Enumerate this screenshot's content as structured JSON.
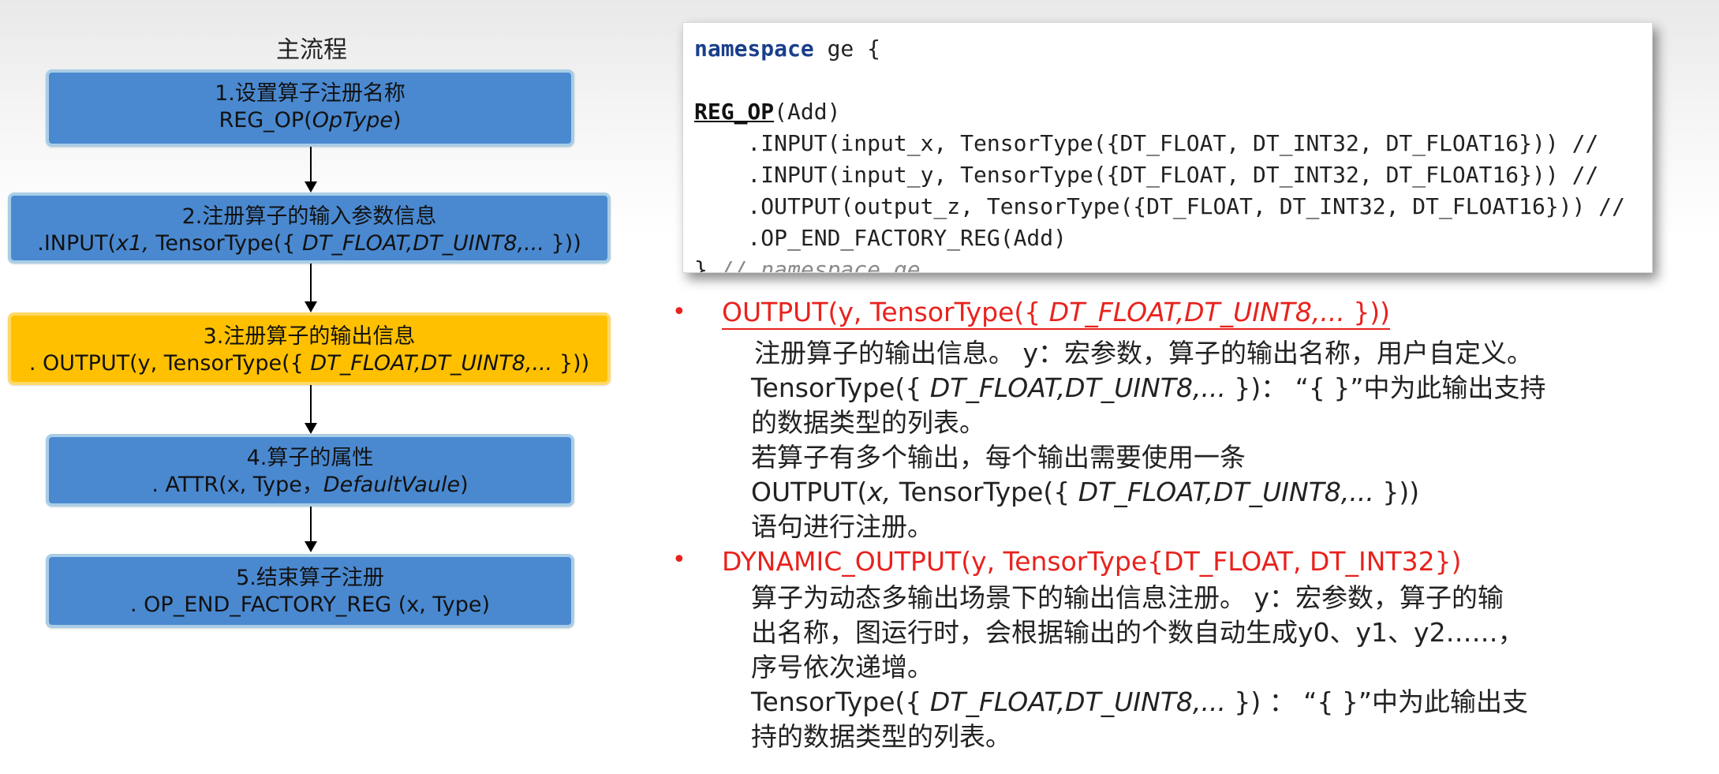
{
  "flow": {
    "title": "主流程",
    "steps": [
      {
        "title": "1.设置算子注册名称",
        "code_pre": "REG_OP(",
        "code_it": "OpType",
        "code_post": ")"
      },
      {
        "title": "2.注册算子的输入参数信息",
        "code_pre": ".INPUT(",
        "code_it": "x1,",
        "code_mid": " TensorType({ ",
        "code_it2": "DT_FLOAT,DT_UINT8,... ",
        "code_post": "}))"
      },
      {
        "title": "3.注册算子的输出信息",
        "code_pre": ". OUTPUT(y, TensorType({ ",
        "code_it": "DT_FLOAT,DT_UINT8,... ",
        "code_post": "}))"
      },
      {
        "title": "4.算子的属性",
        "code_pre": ". ATTR(x, Type，",
        "code_it": "DefaultVaule",
        "code_post": ")"
      },
      {
        "title": "5.结束算子注册",
        "code_pre": ". OP_END_FACTORY_REG (x, Type)"
      }
    ],
    "colors": {
      "blue": "#4a89d0",
      "orange": "#ffc000"
    }
  },
  "code": {
    "ns_kw": "namespace",
    "ns_rest": " ge {",
    "reg_kw": "REG_OP",
    "reg_rest": "(Add)",
    "l1": "    .INPUT(input_x, TensorType({DT_FLOAT, DT_INT32, DT_FLOAT16})) //",
    "l2": "    .INPUT(input_y, TensorType({DT_FLOAT, DT_INT32, DT_FLOAT16})) //",
    "l3": "    .OUTPUT(output_z, TensorType({DT_FLOAT, DT_INT32, DT_FLOAT16})) //",
    "l4": "    .OP_END_FACTORY_REG(Add)",
    "close_brace": "}",
    "close_comment": " // namespace ge"
  },
  "notes": {
    "b1_pre": "OUTPUT(y, TensorType({ ",
    "b1_it": "DT_FLOAT,DT_UINT8,... ",
    "b1_post": "}))",
    "b1_l1": "注册算子的输出信息。 y：宏参数，算子的输出名称，用户自定义。",
    "b1_l2_pre": "TensorType({ ",
    "b1_l2_it": "DT_FLOAT,DT_UINT8,... ",
    "b1_l2_post": "})： “{ }”中为此输出支持",
    "b1_l3": "的数据类型的列表。",
    "b1_l4": "若算子有多个输出，每个输出需要使用一条",
    "b1_l5_pre": "OUTPUT(",
    "b1_l5_it": "x,",
    "b1_l5_mid": " TensorType({ ",
    "b1_l5_it2": "DT_FLOAT,DT_UINT8,... ",
    "b1_l5_post": "}))",
    "b1_l6": "语句进行注册。",
    "b2": "DYNAMIC_OUTPUT(y, TensorType{DT_FLOAT, DT_INT32})",
    "b2_l1": "算子为动态多输出场景下的输出信息注册。 y：宏参数，算子的输",
    "b2_l2": "出名称，图运行时，会根据输出的个数自动生成y0、y1、y2……，",
    "b2_l3": "序号依次递增。",
    "b2_l4_pre": "TensorType({ ",
    "b2_l4_it": "DT_FLOAT,DT_UINT8,... ",
    "b2_l4_post": "}) ： “{ }”中为此输出支",
    "b2_l5": "持的数据类型的列表。",
    "bullet_char": "•",
    "accent_red": "#e8221d"
  }
}
